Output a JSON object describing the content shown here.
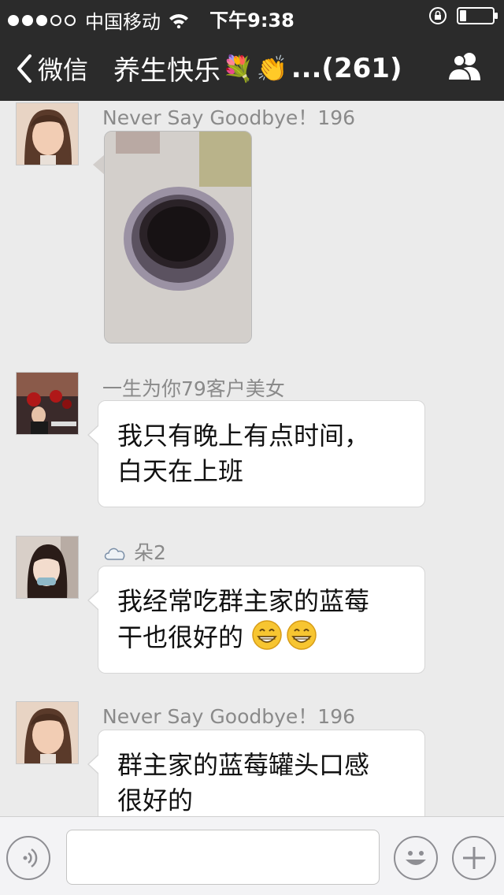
{
  "status_bar": {
    "carrier": "中国移动",
    "time": "下午9:38",
    "battery_level": 0.2,
    "signal_bars": 3
  },
  "nav": {
    "back_label": "微信",
    "title": "养生快乐",
    "title_emojis": [
      "💐",
      "👏"
    ],
    "title_count": "...(261)"
  },
  "messages": [
    {
      "sender": "Never Say Goodbye！196",
      "type": "image"
    },
    {
      "sender": "一生为你79客户美女",
      "type": "text",
      "lines": [
        "我只有晚上有点时间，",
        "白天在上班"
      ]
    },
    {
      "sender_icon": "cloud-icon",
      "sender": "朵2",
      "type": "text",
      "lines": [
        "我经常吃群主家的蓝莓",
        "干也很好的"
      ],
      "trailing_emoji": "grinning-face-icon"
    },
    {
      "sender": "Never Say Goodbye！196",
      "type": "text",
      "lines": [
        "群主家的蓝莓罐头口感",
        "很好的"
      ]
    }
  ],
  "input_bar": {
    "text": "",
    "icons": [
      "voice-icon",
      "emoji-icon",
      "plus-icon"
    ]
  },
  "colors": {
    "header_bg": "#2b2b2b",
    "chat_bg": "#ebebeb",
    "bubble_bg": "#ffffff"
  }
}
